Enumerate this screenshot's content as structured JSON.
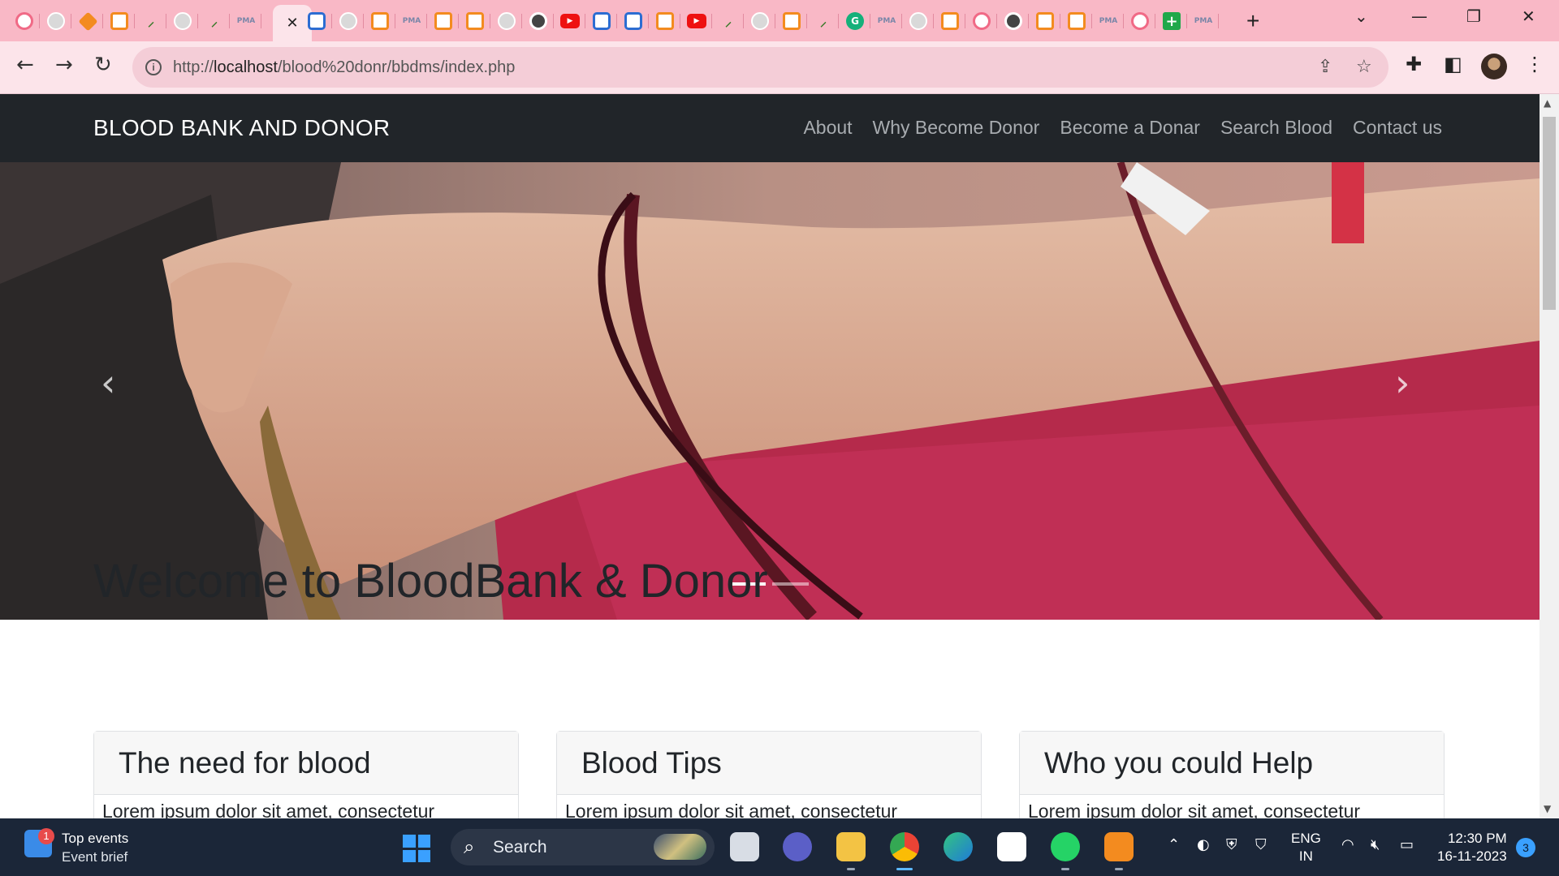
{
  "browser": {
    "tabs": [
      {
        "icon": "github-icon"
      },
      {
        "icon": "globe-icon"
      },
      {
        "icon": "diamond-icon"
      },
      {
        "icon": "xampp-icon"
      },
      {
        "icon": "leaf-icon"
      },
      {
        "icon": "globe-icon"
      },
      {
        "icon": "leaf-icon"
      },
      {
        "icon": "pma-icon"
      },
      {
        "icon": "shield-icon"
      },
      {
        "icon": "globe-icon"
      },
      {
        "icon": "xampp-icon"
      },
      {
        "icon": "pma-icon"
      },
      {
        "icon": "xampp-icon"
      },
      {
        "icon": "xampp-icon"
      },
      {
        "icon": "globe-icon"
      },
      {
        "icon": "chrome-icon"
      },
      {
        "icon": "youtube-icon"
      },
      {
        "icon": "shield-icon"
      },
      {
        "icon": "shield-icon"
      },
      {
        "icon": "xampp-icon"
      },
      {
        "icon": "youtube-icon"
      },
      {
        "icon": "leaf-icon"
      },
      {
        "icon": "globe-icon"
      },
      {
        "icon": "xampp-icon"
      },
      {
        "icon": "leaf-icon"
      },
      {
        "icon": "grammarly-icon"
      },
      {
        "icon": "pma-icon"
      },
      {
        "icon": "globe-icon"
      },
      {
        "icon": "xampp-icon"
      },
      {
        "icon": "github-icon"
      },
      {
        "icon": "chrome-icon"
      },
      {
        "icon": "xampp-icon"
      },
      {
        "icon": "xampp-icon"
      },
      {
        "icon": "pma-icon"
      },
      {
        "icon": "github-icon"
      },
      {
        "icon": "plus-app-icon"
      },
      {
        "icon": "pma-icon"
      }
    ],
    "url_prefix": "http://",
    "url_host": "localhost",
    "url_path": "/blood%20donr/bbdms/index.php",
    "accent": "#f9b8c6"
  },
  "site": {
    "brand": "BLOOD BANK AND DONOR",
    "nav": [
      "About",
      "Why Become Donor",
      "Become a Donar",
      "Search Blood",
      "Contact us"
    ],
    "carousel": {
      "slides": 2,
      "active": 1,
      "prev": "‹",
      "next": "›"
    },
    "welcome": "Welcome to BloodBank & Donor",
    "cards": [
      {
        "title": "The need for blood",
        "text": "Lorem ipsum dolor sit amet, consectetur"
      },
      {
        "title": "Blood Tips",
        "text": "Lorem ipsum dolor sit amet, consectetur"
      },
      {
        "title": "Who you could Help",
        "text": "Lorem ipsum dolor sit amet, consectetur"
      }
    ]
  },
  "taskbar": {
    "widget_title": "Top events",
    "widget_sub": "Event brief",
    "widget_badge": "1",
    "search_label": "Search",
    "lang_top": "ENG",
    "lang_bottom": "IN",
    "time": "12:30 PM",
    "date": "16-11-2023",
    "notifications": "3"
  }
}
